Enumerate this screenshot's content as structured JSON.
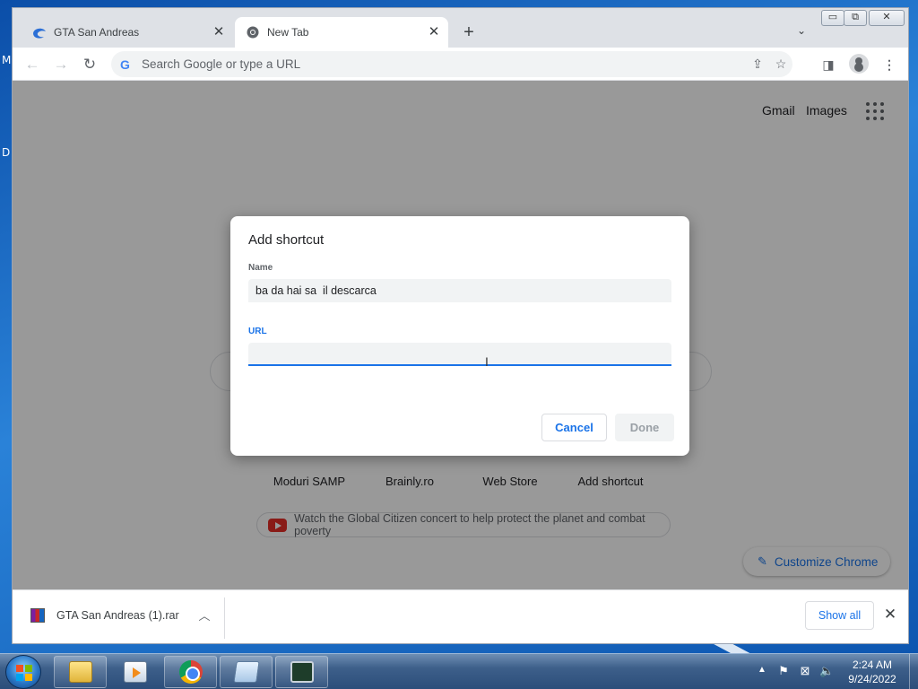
{
  "desktop": {
    "left_glyphs": [
      "M",
      "D"
    ]
  },
  "browser": {
    "tabs": [
      {
        "label": "GTA San Andreas",
        "icon": "edge-icon",
        "active": false
      },
      {
        "label": "New Tab",
        "icon": "chrome-icon",
        "active": true
      }
    ],
    "omnibox": {
      "placeholder": "Search Google or type a URL"
    },
    "window_controls": {
      "minimize": "▭",
      "restore": "⧉",
      "close": "✕"
    }
  },
  "ntp": {
    "links": [
      "Gmail",
      "Images"
    ],
    "shortcuts": [
      "Moduri SAMP",
      "Brainly.ro",
      "Web Store",
      "Add shortcut"
    ],
    "promo": "Watch the Global Citizen concert to help protect the planet and combat poverty",
    "customize_label": "Customize Chrome"
  },
  "dialog": {
    "title": "Add shortcut",
    "name_label": "Name",
    "name_value": "ba da hai sa  il descarca",
    "url_label": "URL",
    "url_value": "",
    "cancel_label": "Cancel",
    "done_label": "Done"
  },
  "downloads": {
    "file_name": "GTA San Andreas (1).rar",
    "show_all_label": "Show all"
  },
  "taskbar": {
    "clock_time": "2:24 AM",
    "clock_date": "9/24/2022"
  },
  "colors": {
    "accent": "#1a73e8",
    "taskbar": "#3d5f8a"
  }
}
